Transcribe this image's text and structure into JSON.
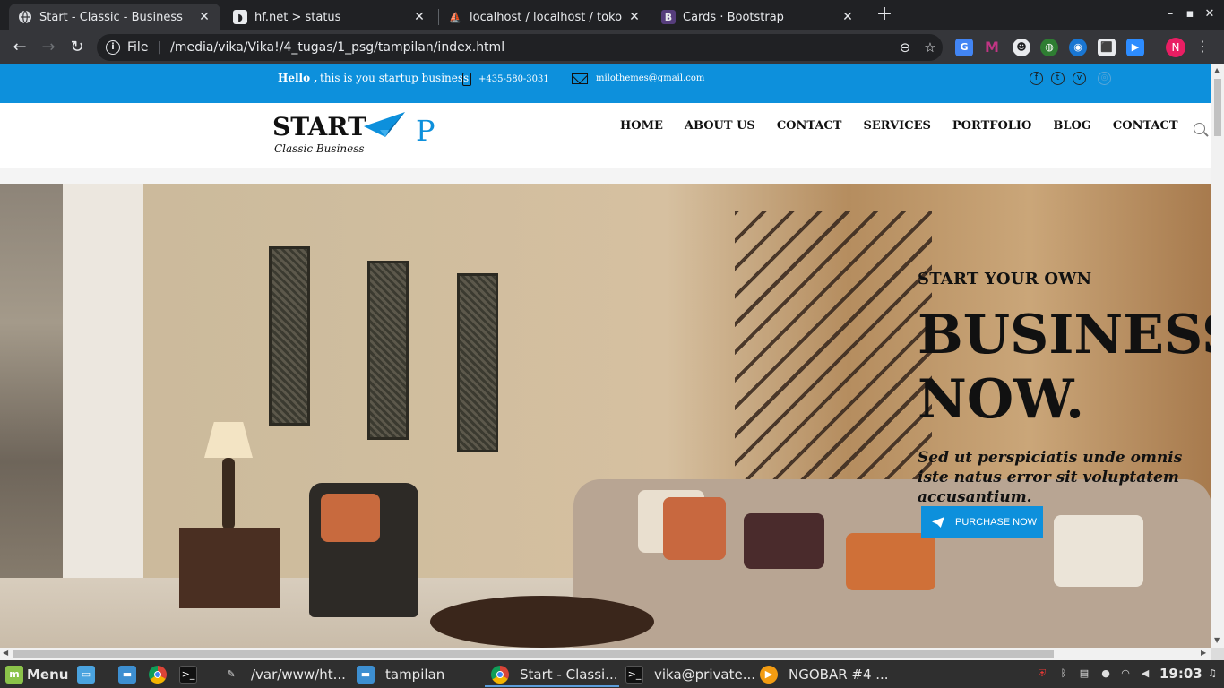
{
  "browser": {
    "tabs": [
      {
        "title": "Start - Classic - Business",
        "favicon": "globe-icon"
      },
      {
        "title": "hf.net > status",
        "favicon": "hf-icon"
      },
      {
        "title": "localhost / localhost / tokoonline",
        "favicon": "phpmyadmin-icon"
      },
      {
        "title": "Cards · Bootstrap",
        "favicon": "bootstrap-icon"
      }
    ],
    "new_tab": "+",
    "url_scheme": "File",
    "url_divider": "|",
    "url": "/media/vika/Vika!/4_tugas/1_psg/tampilan/index.html",
    "profile_initial": "N"
  },
  "site": {
    "topbar": {
      "hello": "Hello ,",
      "tagline": "this is you startup business.",
      "phone": "+435-580-3031",
      "email": "milothemes@gmail.com",
      "social": [
        "facebook-icon",
        "twitter-icon",
        "vimeo-icon",
        "dribbble-icon"
      ]
    },
    "logo": {
      "text": "START",
      "p": "P",
      "subtitle": "Classic Business"
    },
    "nav": [
      "HOME",
      "ABOUT US",
      "CONTACT",
      "SERVICES",
      "PORTFOLIO",
      "BLOG",
      "CONTACT"
    ],
    "hero": {
      "kicker": "START YOUR OWN",
      "title_line1": "BUSINESS",
      "title_line2": "NOW.",
      "subtitle": "Sed ut perspiciatis unde omnis iste natus error sit voluptatem accusantium.",
      "cta": "PURCHASE NOW"
    }
  },
  "taskbar": {
    "menu_label": "Menu",
    "windows": [
      {
        "label": "/var/www/ht..."
      },
      {
        "label": "tampilan"
      },
      {
        "label": "Start - Classi..."
      },
      {
        "label": "vika@private..."
      },
      {
        "label": "NGOBAR #4 ..."
      }
    ],
    "clock": "19:03"
  },
  "colors": {
    "accent": "#0d90dc",
    "chrome_dark": "#202124",
    "chrome_toolbar": "#35363a"
  }
}
